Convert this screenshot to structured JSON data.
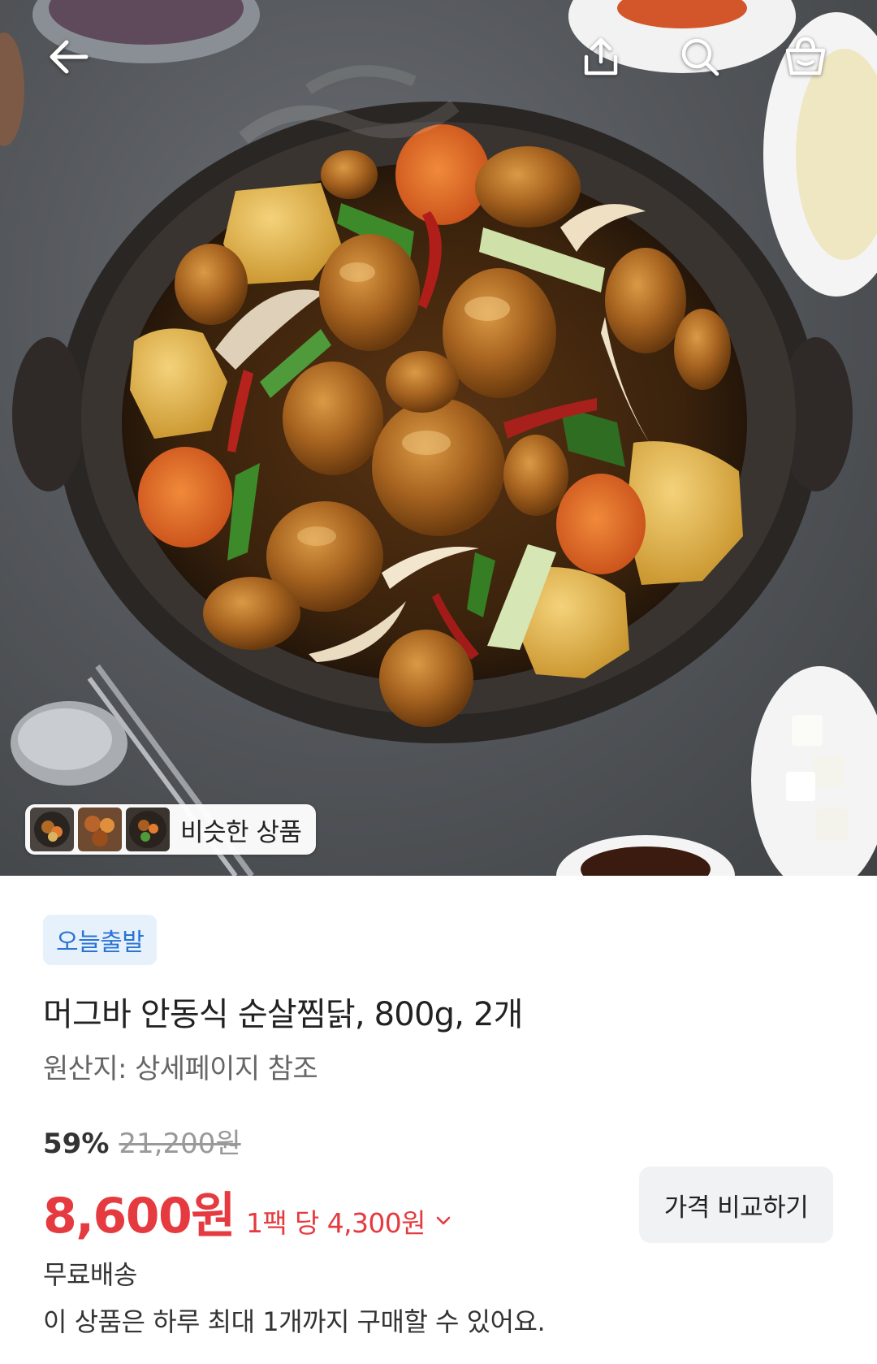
{
  "header": {
    "back_icon": "arrow-left-icon",
    "share_icon": "share-upload-icon",
    "search_icon": "search-icon",
    "cart_icon": "shopping-bag-icon"
  },
  "hero": {
    "similar_label": "비슷한 상품"
  },
  "product": {
    "badge": "오늘출발",
    "title": "머그바 안동식 순살찜닭, 800g, 2개",
    "origin": "원산지: 상세페이지 참조",
    "discount": "59%",
    "original_price": "21,200원",
    "price": "8,600원",
    "unit_price": "1팩 당 4,300원",
    "compare_button": "가격 비교하기",
    "shipping": "무료배송",
    "purchase_limit": "이 상품은 하루 최대 1개까지 구매할 수 있어요."
  },
  "colors": {
    "price_red": "#e53a3f",
    "badge_blue": "#2a74d4",
    "badge_bg": "#e6f1fc"
  }
}
